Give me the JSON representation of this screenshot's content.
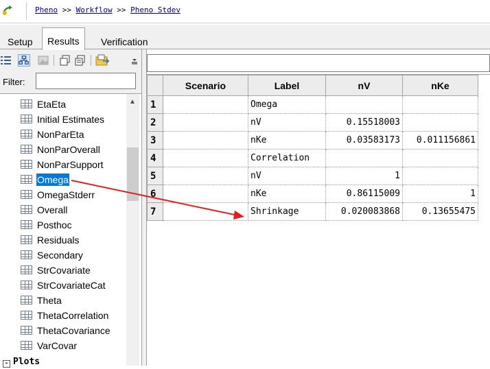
{
  "breadcrumb": {
    "items": [
      "Pheno",
      "Workflow",
      "Pheno Stdev"
    ],
    "separator": ">>"
  },
  "tabs": [
    {
      "label": "Setup",
      "active": false
    },
    {
      "label": "Results",
      "active": true
    },
    {
      "label": "Verification",
      "active": false
    }
  ],
  "left_pane": {
    "toolbar_icons": [
      "list-view-icon",
      "tree-view-icon",
      "image-icon",
      "copy-icon",
      "copy-all-icon",
      "export-icon",
      "dropdown-icon"
    ],
    "filter_label": "Filter:",
    "filter_value": "",
    "tree_items": [
      {
        "label": "EtaEta",
        "selected": false
      },
      {
        "label": "Initial Estimates",
        "selected": false
      },
      {
        "label": "NonParEta",
        "selected": false
      },
      {
        "label": "NonParOverall",
        "selected": false
      },
      {
        "label": "NonParSupport",
        "selected": false
      },
      {
        "label": "Omega",
        "selected": true
      },
      {
        "label": "OmegaStderr",
        "selected": false
      },
      {
        "label": "Overall",
        "selected": false
      },
      {
        "label": "Posthoc",
        "selected": false
      },
      {
        "label": "Residuals",
        "selected": false
      },
      {
        "label": "Secondary",
        "selected": false
      },
      {
        "label": "StrCovariate",
        "selected": false
      },
      {
        "label": "StrCovariateCat",
        "selected": false
      },
      {
        "label": "Theta",
        "selected": false
      },
      {
        "label": "ThetaCorrelation",
        "selected": false
      },
      {
        "label": "ThetaCovariance",
        "selected": false
      },
      {
        "label": "VarCovar",
        "selected": false
      }
    ],
    "plots_label": "Plots",
    "plots_toggle": "-"
  },
  "grid": {
    "columns": [
      "Scenario",
      "Label",
      "nV",
      "nKe"
    ],
    "rows": [
      {
        "num": "1",
        "scenario": "",
        "label": "Omega",
        "nV": "",
        "nKe": ""
      },
      {
        "num": "2",
        "scenario": "",
        "label": "nV",
        "nV": "0.15518003",
        "nKe": ""
      },
      {
        "num": "3",
        "scenario": "",
        "label": "nKe",
        "nV": "0.03583173",
        "nKe": "0.011156861"
      },
      {
        "num": "4",
        "scenario": "",
        "label": "Correlation",
        "nV": "",
        "nKe": ""
      },
      {
        "num": "5",
        "scenario": "",
        "label": "nV",
        "nV": "1",
        "nKe": ""
      },
      {
        "num": "6",
        "scenario": "",
        "label": "nKe",
        "nV": "0.86115009",
        "nKe": "1"
      },
      {
        "num": "7",
        "scenario": "",
        "label": "Shrinkage",
        "nV": "0.020083868",
        "nKe": "0.13655475"
      }
    ]
  },
  "colors": {
    "selection": "#0078d7",
    "arrow": "#e02020",
    "link": "#000080"
  }
}
